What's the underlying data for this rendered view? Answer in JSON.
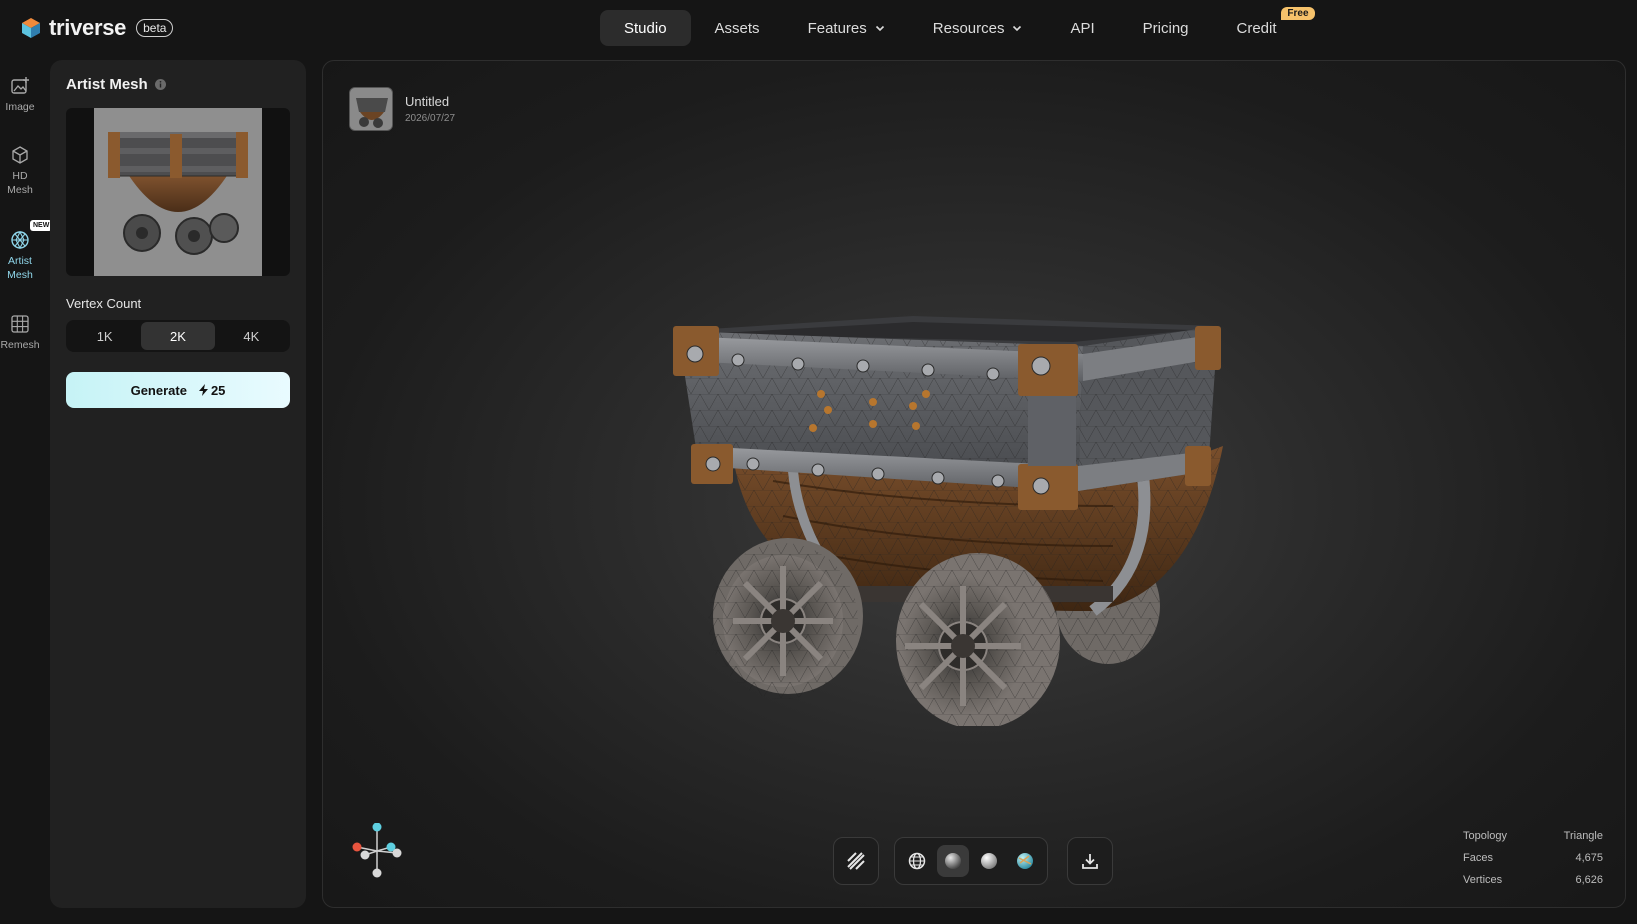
{
  "brand": {
    "name": "triverse",
    "badge": "beta"
  },
  "nav": {
    "items": [
      {
        "label": "Studio",
        "active": true,
        "dropdown": false
      },
      {
        "label": "Assets",
        "active": false,
        "dropdown": false
      },
      {
        "label": "Features",
        "active": false,
        "dropdown": true
      },
      {
        "label": "Resources",
        "active": false,
        "dropdown": true
      },
      {
        "label": "API",
        "active": false,
        "dropdown": false
      },
      {
        "label": "Pricing",
        "active": false,
        "dropdown": false
      },
      {
        "label": "Credit",
        "active": false,
        "dropdown": false,
        "badge": "Free"
      }
    ]
  },
  "rail": {
    "items": [
      {
        "label": "Image",
        "icon": "image-plus-icon"
      },
      {
        "label": "HD Mesh",
        "icon": "cube-icon"
      },
      {
        "label": "Artist Mesh",
        "icon": "mesh-sphere-icon",
        "badge": "NEW",
        "active": true
      },
      {
        "label": "Remesh",
        "icon": "grid-icon"
      }
    ]
  },
  "panel": {
    "title": "Artist Mesh",
    "vertex_label": "Vertex Count",
    "vertex_options": [
      "1K",
      "2K",
      "4K"
    ],
    "vertex_selected": "2K",
    "generate_label": "Generate",
    "generate_cost": "25"
  },
  "viewport": {
    "doc_title": "Untitled",
    "doc_date": "2026/07/27",
    "stats": [
      {
        "label": "Topology",
        "value": "Triangle"
      },
      {
        "label": "Faces",
        "value": "4,675"
      },
      {
        "label": "Vertices",
        "value": "6,626"
      }
    ]
  },
  "colors": {
    "accent": "#8fd6ea",
    "generate_bg": "#c6f3f6",
    "free_badge": "#f6c26b"
  }
}
